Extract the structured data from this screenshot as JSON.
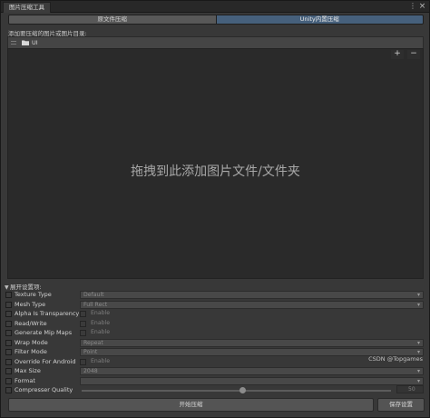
{
  "window": {
    "title": "图片压缩工具"
  },
  "tabs": [
    {
      "label": "原文件压缩",
      "active": false
    },
    {
      "label": "Unity内置压缩",
      "active": true
    }
  ],
  "section_label": "添加要压缩的图片或图片目录:",
  "folder_item": {
    "label": "UI",
    "icon": "folder-icon"
  },
  "list_buttons": {
    "add": "+",
    "remove": "−"
  },
  "drop_hint": "拖拽到此添加图片文件/文件夹",
  "settings": {
    "header": "展开设置项:",
    "rows": [
      {
        "label": "Texture Type",
        "kind": "dropdown",
        "value": "Default"
      },
      {
        "label": "Mesh Type",
        "kind": "dropdown",
        "value": "Full Rect"
      },
      {
        "label": "Alpha Is Transparency",
        "kind": "toggle",
        "value": "Enable"
      },
      {
        "label": "Read/Write",
        "kind": "toggle",
        "value": "Enable"
      },
      {
        "label": "Generate Mip Maps",
        "kind": "toggle",
        "value": "Enable"
      },
      {
        "label": "Wrap Mode",
        "kind": "dropdown",
        "value": "Repeat"
      },
      {
        "label": "Filter Mode",
        "kind": "dropdown",
        "value": "Point"
      },
      {
        "label": "Override For Android",
        "kind": "toggle",
        "value": "Enable"
      },
      {
        "label": "Max Size",
        "kind": "dropdown",
        "value": "2048"
      },
      {
        "label": "Format",
        "kind": "dropdown",
        "value": ""
      },
      {
        "label": "Compresser Quality",
        "kind": "slider",
        "value": "50",
        "fraction": 0.5
      }
    ]
  },
  "buttons": {
    "compress": "开始压缩",
    "save": "保存设置"
  },
  "watermark": "CSDN @Topgames",
  "colors": {
    "accent_tab": "#46607c",
    "background": "#383838",
    "dropzone": "#2a2a2a"
  }
}
